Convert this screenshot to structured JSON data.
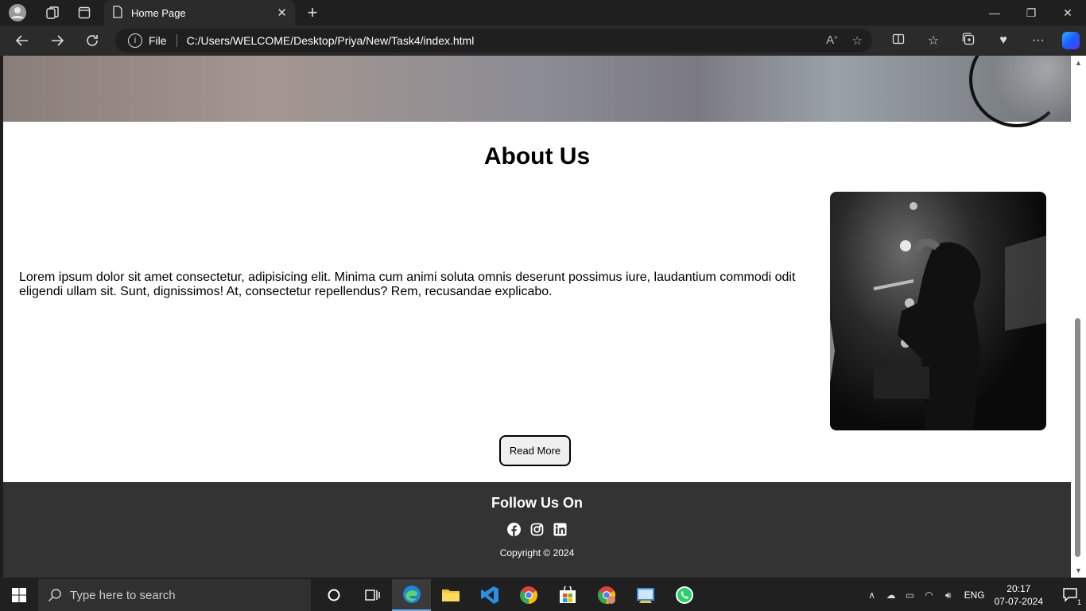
{
  "browser": {
    "tab_title": "Home Page",
    "address_scheme": "File",
    "address_url": "C:/Users/WELCOME/Desktop/Priya/New/Task4/index.html"
  },
  "page": {
    "about": {
      "title": "About Us",
      "text": "Lorem ipsum dolor sit amet consectetur, adipisicing elit. Minima cum animi soluta omnis deserunt possimus iure, laudantium commodi odit eligendi ullam sit. Sunt, dignissimos! At, consectetur repellendus? Rem, recusandae explicabo.",
      "button_label": "Read More"
    },
    "footer": {
      "heading": "Follow Us On",
      "socials": [
        "facebook-icon",
        "instagram-icon",
        "linkedin-icon"
      ],
      "copyright": "Copyright © 2024"
    }
  },
  "taskbar": {
    "search_placeholder": "Type here to search",
    "language": "ENG",
    "time": "20:17",
    "date": "07-07-2024",
    "notification_count": "1"
  }
}
